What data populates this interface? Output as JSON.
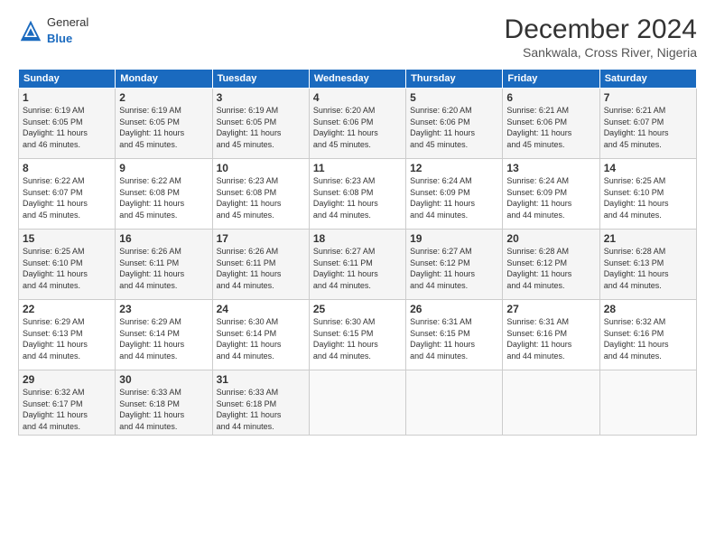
{
  "header": {
    "logo_general": "General",
    "logo_blue": "Blue",
    "title": "December 2024",
    "subtitle": "Sankwala, Cross River, Nigeria"
  },
  "weekdays": [
    "Sunday",
    "Monday",
    "Tuesday",
    "Wednesday",
    "Thursday",
    "Friday",
    "Saturday"
  ],
  "weeks": [
    [
      {
        "day": "1",
        "lines": [
          "Sunrise: 6:19 AM",
          "Sunset: 6:05 PM",
          "Daylight: 11 hours",
          "and 46 minutes."
        ]
      },
      {
        "day": "2",
        "lines": [
          "Sunrise: 6:19 AM",
          "Sunset: 6:05 PM",
          "Daylight: 11 hours",
          "and 45 minutes."
        ]
      },
      {
        "day": "3",
        "lines": [
          "Sunrise: 6:19 AM",
          "Sunset: 6:05 PM",
          "Daylight: 11 hours",
          "and 45 minutes."
        ]
      },
      {
        "day": "4",
        "lines": [
          "Sunrise: 6:20 AM",
          "Sunset: 6:06 PM",
          "Daylight: 11 hours",
          "and 45 minutes."
        ]
      },
      {
        "day": "5",
        "lines": [
          "Sunrise: 6:20 AM",
          "Sunset: 6:06 PM",
          "Daylight: 11 hours",
          "and 45 minutes."
        ]
      },
      {
        "day": "6",
        "lines": [
          "Sunrise: 6:21 AM",
          "Sunset: 6:06 PM",
          "Daylight: 11 hours",
          "and 45 minutes."
        ]
      },
      {
        "day": "7",
        "lines": [
          "Sunrise: 6:21 AM",
          "Sunset: 6:07 PM",
          "Daylight: 11 hours",
          "and 45 minutes."
        ]
      }
    ],
    [
      {
        "day": "8",
        "lines": [
          "Sunrise: 6:22 AM",
          "Sunset: 6:07 PM",
          "Daylight: 11 hours",
          "and 45 minutes."
        ]
      },
      {
        "day": "9",
        "lines": [
          "Sunrise: 6:22 AM",
          "Sunset: 6:08 PM",
          "Daylight: 11 hours",
          "and 45 minutes."
        ]
      },
      {
        "day": "10",
        "lines": [
          "Sunrise: 6:23 AM",
          "Sunset: 6:08 PM",
          "Daylight: 11 hours",
          "and 45 minutes."
        ]
      },
      {
        "day": "11",
        "lines": [
          "Sunrise: 6:23 AM",
          "Sunset: 6:08 PM",
          "Daylight: 11 hours",
          "and 44 minutes."
        ]
      },
      {
        "day": "12",
        "lines": [
          "Sunrise: 6:24 AM",
          "Sunset: 6:09 PM",
          "Daylight: 11 hours",
          "and 44 minutes."
        ]
      },
      {
        "day": "13",
        "lines": [
          "Sunrise: 6:24 AM",
          "Sunset: 6:09 PM",
          "Daylight: 11 hours",
          "and 44 minutes."
        ]
      },
      {
        "day": "14",
        "lines": [
          "Sunrise: 6:25 AM",
          "Sunset: 6:10 PM",
          "Daylight: 11 hours",
          "and 44 minutes."
        ]
      }
    ],
    [
      {
        "day": "15",
        "lines": [
          "Sunrise: 6:25 AM",
          "Sunset: 6:10 PM",
          "Daylight: 11 hours",
          "and 44 minutes."
        ]
      },
      {
        "day": "16",
        "lines": [
          "Sunrise: 6:26 AM",
          "Sunset: 6:11 PM",
          "Daylight: 11 hours",
          "and 44 minutes."
        ]
      },
      {
        "day": "17",
        "lines": [
          "Sunrise: 6:26 AM",
          "Sunset: 6:11 PM",
          "Daylight: 11 hours",
          "and 44 minutes."
        ]
      },
      {
        "day": "18",
        "lines": [
          "Sunrise: 6:27 AM",
          "Sunset: 6:11 PM",
          "Daylight: 11 hours",
          "and 44 minutes."
        ]
      },
      {
        "day": "19",
        "lines": [
          "Sunrise: 6:27 AM",
          "Sunset: 6:12 PM",
          "Daylight: 11 hours",
          "and 44 minutes."
        ]
      },
      {
        "day": "20",
        "lines": [
          "Sunrise: 6:28 AM",
          "Sunset: 6:12 PM",
          "Daylight: 11 hours",
          "and 44 minutes."
        ]
      },
      {
        "day": "21",
        "lines": [
          "Sunrise: 6:28 AM",
          "Sunset: 6:13 PM",
          "Daylight: 11 hours",
          "and 44 minutes."
        ]
      }
    ],
    [
      {
        "day": "22",
        "lines": [
          "Sunrise: 6:29 AM",
          "Sunset: 6:13 PM",
          "Daylight: 11 hours",
          "and 44 minutes."
        ]
      },
      {
        "day": "23",
        "lines": [
          "Sunrise: 6:29 AM",
          "Sunset: 6:14 PM",
          "Daylight: 11 hours",
          "and 44 minutes."
        ]
      },
      {
        "day": "24",
        "lines": [
          "Sunrise: 6:30 AM",
          "Sunset: 6:14 PM",
          "Daylight: 11 hours",
          "and 44 minutes."
        ]
      },
      {
        "day": "25",
        "lines": [
          "Sunrise: 6:30 AM",
          "Sunset: 6:15 PM",
          "Daylight: 11 hours",
          "and 44 minutes."
        ]
      },
      {
        "day": "26",
        "lines": [
          "Sunrise: 6:31 AM",
          "Sunset: 6:15 PM",
          "Daylight: 11 hours",
          "and 44 minutes."
        ]
      },
      {
        "day": "27",
        "lines": [
          "Sunrise: 6:31 AM",
          "Sunset: 6:16 PM",
          "Daylight: 11 hours",
          "and 44 minutes."
        ]
      },
      {
        "day": "28",
        "lines": [
          "Sunrise: 6:32 AM",
          "Sunset: 6:16 PM",
          "Daylight: 11 hours",
          "and 44 minutes."
        ]
      }
    ],
    [
      {
        "day": "29",
        "lines": [
          "Sunrise: 6:32 AM",
          "Sunset: 6:17 PM",
          "Daylight: 11 hours",
          "and 44 minutes."
        ]
      },
      {
        "day": "30",
        "lines": [
          "Sunrise: 6:33 AM",
          "Sunset: 6:18 PM",
          "Daylight: 11 hours",
          "and 44 minutes."
        ]
      },
      {
        "day": "31",
        "lines": [
          "Sunrise: 6:33 AM",
          "Sunset: 6:18 PM",
          "Daylight: 11 hours",
          "and 44 minutes."
        ]
      },
      null,
      null,
      null,
      null
    ]
  ]
}
